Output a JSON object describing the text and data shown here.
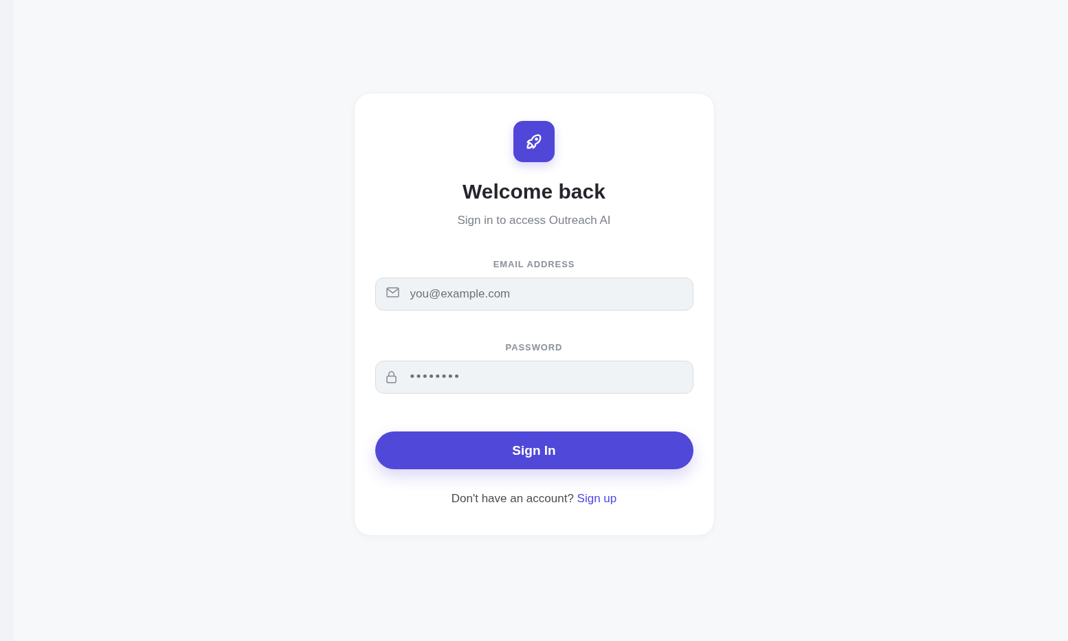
{
  "title": "Welcome back",
  "subtitle": "Sign in to access Outreach AI",
  "fields": [
    {
      "kind": "email",
      "label": "EMAIL ADDRESS",
      "placeholder": "you@example.com"
    },
    {
      "kind": "password",
      "label": "PASSWORD",
      "placeholder": "••••••••"
    }
  ],
  "submit_button": "Sign In",
  "footer": {
    "text": "Don't have an account?",
    "link": "Sign up"
  }
}
